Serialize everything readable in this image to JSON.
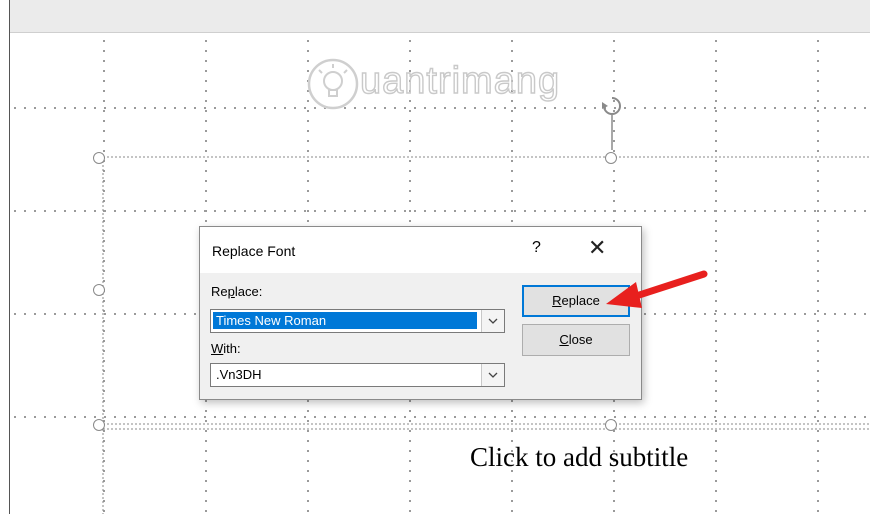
{
  "watermark": {
    "text": "uantrimang",
    "icon_name": "lightbulb-icon"
  },
  "slide": {
    "subtitle_placeholder": "Click to add subtitle"
  },
  "dialog": {
    "title": "Replace Font",
    "help_label": "?",
    "close_label": "✕",
    "replace_label_prefix": "Re",
    "replace_label_accel": "p",
    "replace_label_suffix": "lace:",
    "replace_value": "Times New Roman",
    "with_label_accel": "W",
    "with_label_suffix": "ith:",
    "with_value": ".Vn3DH",
    "replace_button": {
      "accel": "R",
      "rest": "eplace"
    },
    "close_button": {
      "accel": "C",
      "rest": "lose"
    }
  },
  "colors": {
    "selection": "#0078d7",
    "annotation_arrow": "#e8201e"
  }
}
